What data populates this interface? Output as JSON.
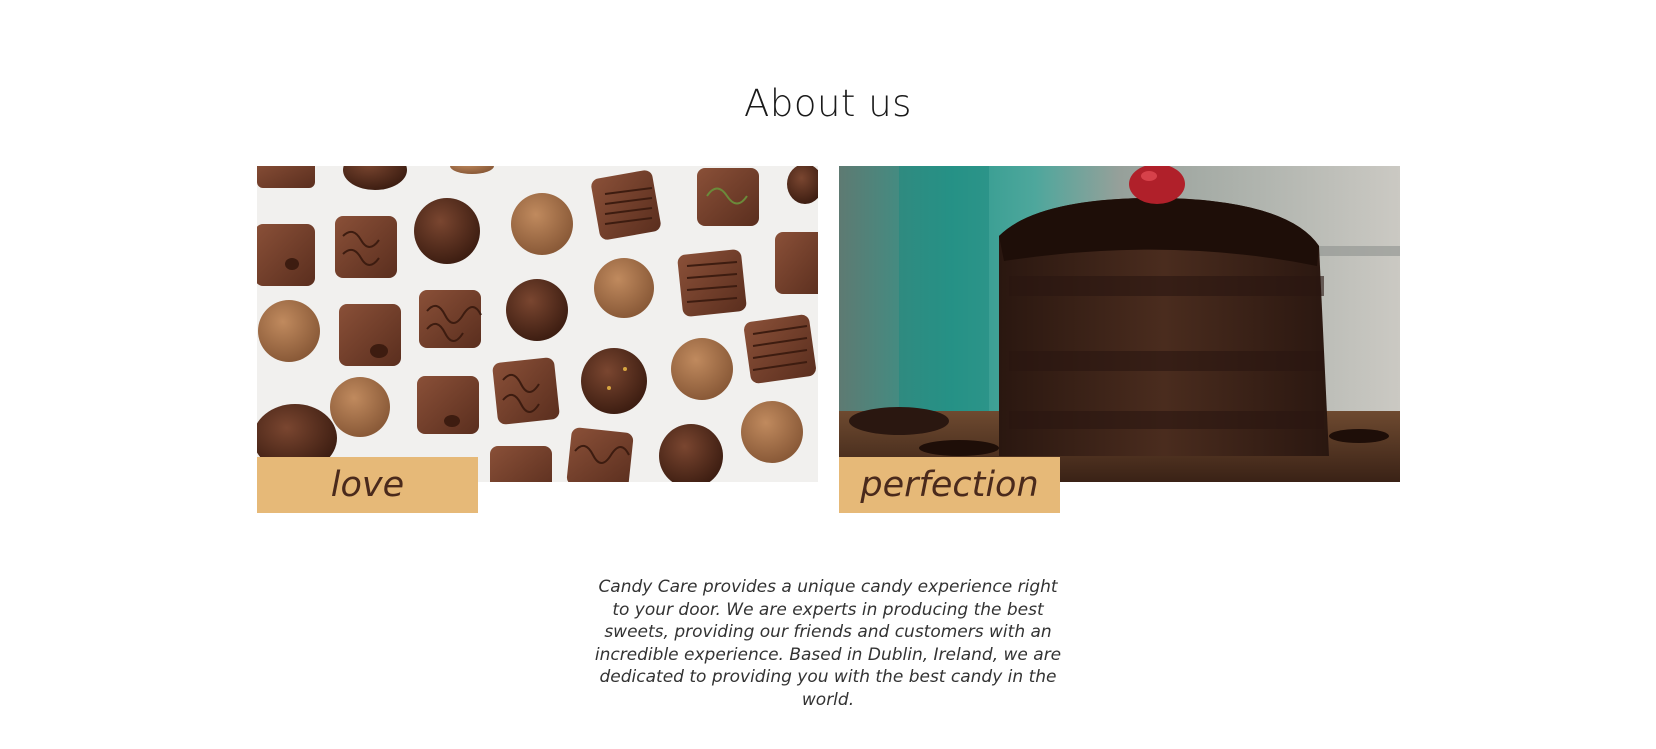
{
  "section": {
    "title": "About us"
  },
  "cards": [
    {
      "image": "assorted-chocolates-photo",
      "label": "love"
    },
    {
      "image": "chocolate-cake-slice-photo",
      "label": "perfection"
    }
  ],
  "description": "Candy Care provides a unique candy experience right to your door. We are experts in producing the best sweets, providing our friends and customers with an incredible experience. Based in Dublin, Ireland, we are dedicated to providing you with the best candy in the world.",
  "colors": {
    "label_background": "#e6b978",
    "label_text": "#4a2a1c",
    "title_text": "#1a1a1a",
    "body_text": "#333333"
  }
}
